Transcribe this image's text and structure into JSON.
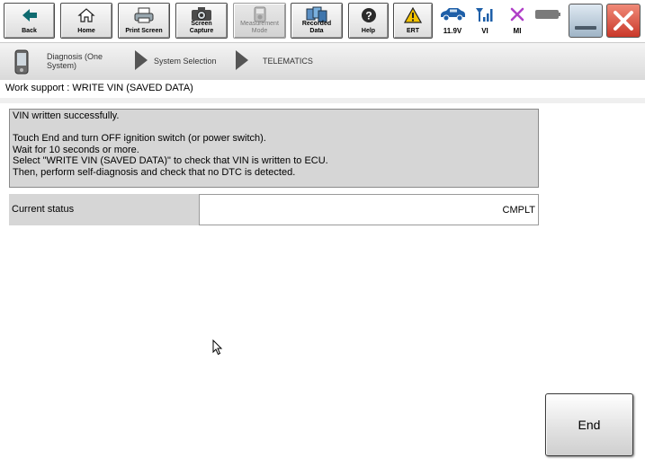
{
  "toolbar": {
    "back_label": "Back",
    "home_label": "Home",
    "print_label": "Print Screen",
    "capture_label": "Screen\nCapture",
    "measurement_label": "Measurement\nMode",
    "recorded_label": "Recorded\nData",
    "help_label": "Help",
    "ert_label": "ERT"
  },
  "status": {
    "voltage": "11.9V",
    "vi_label": "VI",
    "mi_label": "MI"
  },
  "breadcrumb": {
    "item1": "Diagnosis (One\nSystem)",
    "item2": "System Selection",
    "item3": "TELEMATICS"
  },
  "page_title": "Work support : WRITE VIN (SAVED DATA)",
  "message": {
    "line1": "VIN written successfully.",
    "line2": "Touch End and turn OFF ignition switch (or power switch).",
    "line3": "Wait for 10 seconds or more.",
    "line4": "Select \"WRITE VIN (SAVED DATA)\" to check that VIN is written to ECU.",
    "line5": "Then, perform self-diagnosis and check that no DTC is detected."
  },
  "current_status": {
    "label": "Current status",
    "value": "CMPLT"
  },
  "end_label": "End",
  "colors": {
    "accent_teal": "#0f6b70",
    "warning_yellow": "#f2c200",
    "close_red": "#d9412e",
    "mi_purple": "#b040c8",
    "vehicle_blue": "#1e5fa8"
  }
}
